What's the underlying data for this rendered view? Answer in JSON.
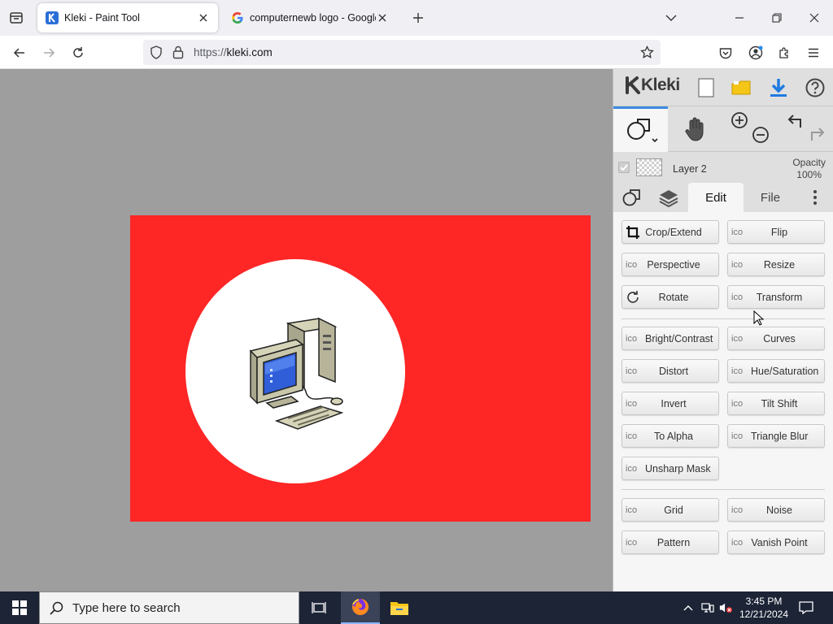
{
  "browser": {
    "tabs": [
      {
        "title": "Kleki - Paint Tool",
        "active": true,
        "favicon": "kleki-favicon"
      },
      {
        "title": "computernewb logo - Google S",
        "active": false,
        "favicon": "google-favicon"
      }
    ],
    "url": {
      "protocol": "https://",
      "host": "kleki.com"
    }
  },
  "kleki": {
    "brand": "Kleki",
    "layer": {
      "name": "Layer 2",
      "opacity_label": "Opacity",
      "opacity_value": "100%"
    },
    "tabs": {
      "edit": "Edit",
      "file": "File"
    },
    "icon_placeholder": "ico",
    "filters": [
      {
        "label": "Crop/Extend",
        "icon": "crop-icon"
      },
      {
        "label": "Flip",
        "icon": "placeholder"
      },
      {
        "label": "Perspective",
        "icon": "placeholder"
      },
      {
        "label": "Resize",
        "icon": "placeholder"
      },
      {
        "label": "Rotate",
        "icon": "rotate-icon"
      },
      {
        "label": "Transform",
        "icon": "placeholder"
      },
      {
        "label": "Bright/Contrast",
        "icon": "placeholder"
      },
      {
        "label": "Curves",
        "icon": "placeholder"
      },
      {
        "label": "Distort",
        "icon": "placeholder"
      },
      {
        "label": "Hue/Saturation",
        "icon": "placeholder"
      },
      {
        "label": "Invert",
        "icon": "placeholder"
      },
      {
        "label": "Tilt Shift",
        "icon": "placeholder"
      },
      {
        "label": "To Alpha",
        "icon": "placeholder"
      },
      {
        "label": "Triangle Blur",
        "icon": "placeholder"
      },
      {
        "label": "Unsharp Mask",
        "icon": "placeholder"
      },
      {
        "label": "Grid",
        "icon": "placeholder"
      },
      {
        "label": "Noise",
        "icon": "placeholder"
      },
      {
        "label": "Pattern",
        "icon": "placeholder"
      },
      {
        "label": "Vanish Point",
        "icon": "placeholder"
      }
    ]
  },
  "canvas": {
    "background_color": "#ff2626",
    "circle_color": "#ffffff"
  },
  "taskbar": {
    "search_placeholder": "Type here to search",
    "time": "3:45 PM",
    "date": "12/21/2024"
  },
  "colors": {
    "accent": "#3c8be0",
    "download_blue": "#1e7be0",
    "folder_yellow": "#f5c518"
  }
}
